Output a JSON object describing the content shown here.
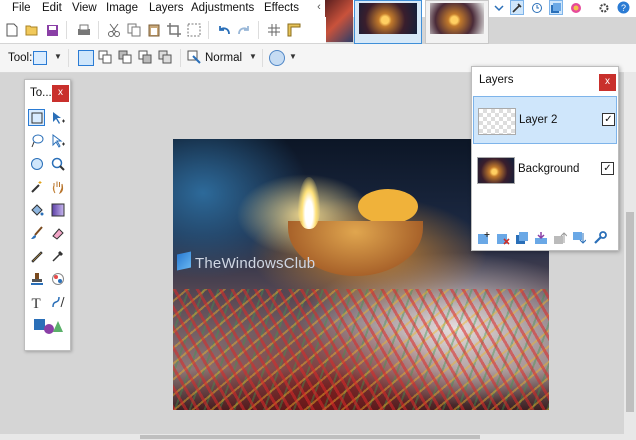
{
  "menu": {
    "file": "File",
    "edit": "Edit",
    "view": "View",
    "image": "Image",
    "layers": "Layers",
    "adjustments": "Adjustments",
    "effects": "Effects"
  },
  "toolbar": {
    "tool_label": "Tool:",
    "blend_mode": "Normal"
  },
  "tools_window": {
    "title": "To...",
    "close": "x"
  },
  "layers_window": {
    "title": "Layers",
    "close": "x",
    "layers": [
      {
        "name": "Layer 2",
        "visible": true,
        "selected": true
      },
      {
        "name": "Background",
        "visible": true,
        "selected": false
      }
    ]
  },
  "canvas": {
    "watermark": "TheWindowsClub"
  },
  "colors": {
    "accent": "#2a7bd4",
    "selection": "#cfe6fb",
    "close_red": "#c9302c"
  },
  "icons": [
    "new-icon",
    "open-icon",
    "save-icon",
    "print-icon",
    "cut-icon",
    "copy-icon",
    "paste-icon",
    "crop-icon",
    "deselect-icon",
    "undo-icon",
    "redo-icon",
    "grid-icon",
    "ruler-icon",
    "tools-toggle-icon",
    "history-icon",
    "layers-toggle-icon",
    "colors-toggle-icon",
    "settings-icon",
    "help-icon"
  ]
}
